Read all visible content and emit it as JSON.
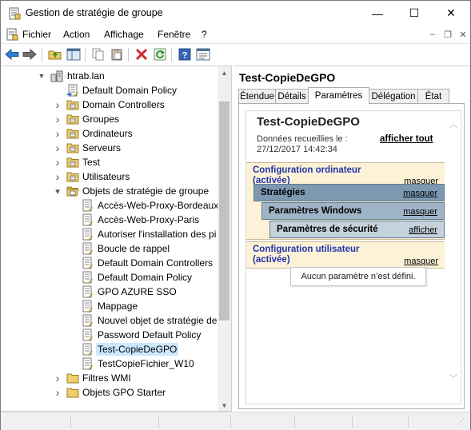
{
  "window": {
    "title": "Gestion de stratégie de groupe",
    "controls": {
      "minimize": "—",
      "maximize": "☐",
      "close": "✕"
    }
  },
  "menu": {
    "items": [
      "Fichier",
      "Action",
      "Affichage",
      "Fenêtre",
      "?"
    ],
    "mdi": {
      "minimize": "–",
      "restore": "❐",
      "close": "✕"
    }
  },
  "toolbar": {
    "buttons": [
      "back-icon",
      "forward-icon",
      "up-folder-icon",
      "show-hide-tree-icon",
      "copy-icon",
      "paste-icon",
      "delete-icon",
      "refresh-icon",
      "help-icon",
      "properties-icon"
    ]
  },
  "tree": {
    "domain": "htrab.lan",
    "items": [
      {
        "label": "Default Domain Policy",
        "type": "gpo-link"
      },
      {
        "label": "Domain Controllers",
        "type": "ou"
      },
      {
        "label": "Groupes",
        "type": "ou"
      },
      {
        "label": "Ordinateurs",
        "type": "ou"
      },
      {
        "label": "Serveurs",
        "type": "ou"
      },
      {
        "label": "Test",
        "type": "ou"
      },
      {
        "label": "Utilisateurs",
        "type": "ou"
      },
      {
        "label": "Objets de stratégie de groupe",
        "type": "folder-open"
      },
      {
        "label": "Accès-Web-Proxy-Bordeaux",
        "type": "gpo"
      },
      {
        "label": "Accès-Web-Proxy-Paris",
        "type": "gpo"
      },
      {
        "label": "Autoriser l'installation des pi",
        "type": "gpo"
      },
      {
        "label": "Boucle de rappel",
        "type": "gpo"
      },
      {
        "label": "Default Domain Controllers",
        "type": "gpo"
      },
      {
        "label": "Default Domain Policy",
        "type": "gpo"
      },
      {
        "label": "GPO AZURE SSO",
        "type": "gpo"
      },
      {
        "label": "Mappage",
        "type": "gpo"
      },
      {
        "label": "Nouvel objet de stratégie de",
        "type": "gpo"
      },
      {
        "label": "Password Default Policy",
        "type": "gpo"
      },
      {
        "label": "Test-CopieDeGPO",
        "type": "gpo",
        "selected": true
      },
      {
        "label": "TestCopieFichier_W10",
        "type": "gpo"
      },
      {
        "label": "Filtres WMI",
        "type": "folder"
      },
      {
        "label": "Objets GPO Starter",
        "type": "folder"
      }
    ]
  },
  "details": {
    "title": "Test-CopieDeGPO",
    "tabs": [
      "Étendue",
      "Détails",
      "Paramètres",
      "Délégation",
      "État"
    ],
    "active_tab": "Paramètres",
    "report": {
      "title": "Test-CopieDeGPO",
      "collected_label": "Données recueillies le : 27/12/2017 14:42:34",
      "show_all": "afficher tout",
      "computer_config": "Configuration ordinateur (activée)",
      "policies": "Stratégies",
      "windows_settings": "Paramètres Windows",
      "security_settings": "Paramètres de sécurité",
      "user_config": "Configuration utilisateur (activée)",
      "hide": "masquer",
      "show": "afficher",
      "no_settings": "Aucun paramètre n’est défini."
    }
  },
  "colors": {
    "selection": "#cce8ff",
    "config_bg": "#fdf2d8",
    "header_blue": "#2233aa",
    "bar_dark": "#7c99b1",
    "bar_mid": "#9fb5c7",
    "bar_light": "#c4d2de"
  }
}
